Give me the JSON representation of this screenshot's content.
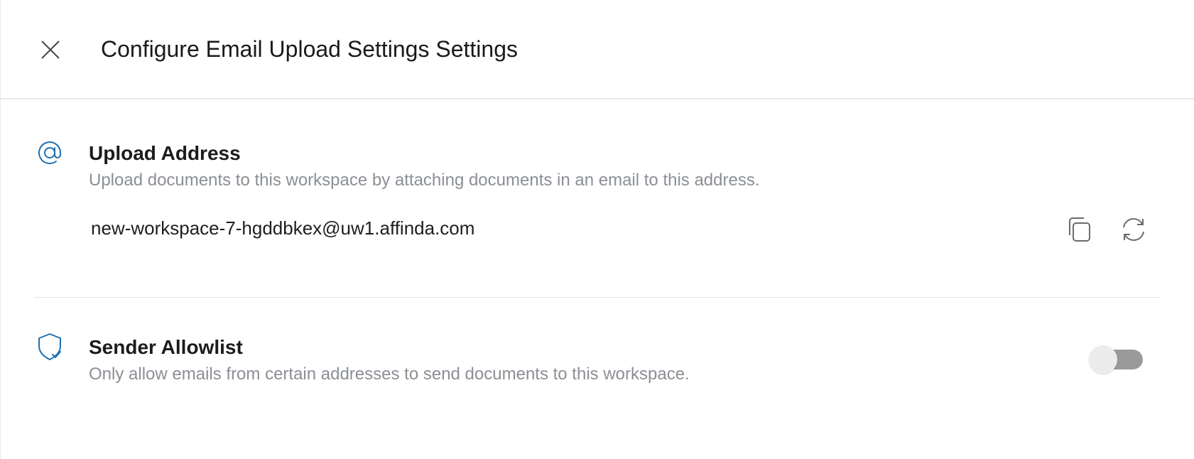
{
  "colors": {
    "accent": "#1f6fb0",
    "muted_text": "#8b8f94",
    "toggle_off_track": "#9a9a9a",
    "toggle_off_knob": "#ececec"
  },
  "header": {
    "title": "Configure Email Upload Settings Settings",
    "close_icon": "close-icon"
  },
  "upload_address": {
    "icon": "at-sign-icon",
    "title": "Upload Address",
    "description": "Upload documents to this workspace by attaching documents in an email to this address.",
    "address": "new-workspace-7-hgddbkex@uw1.affinda.com",
    "copy_icon": "copy-icon",
    "refresh_icon": "refresh-icon"
  },
  "sender_allowlist": {
    "icon": "shield-check-icon",
    "title": "Sender Allowlist",
    "description": "Only allow emails from certain addresses to send documents to this workspace.",
    "enabled": false
  }
}
